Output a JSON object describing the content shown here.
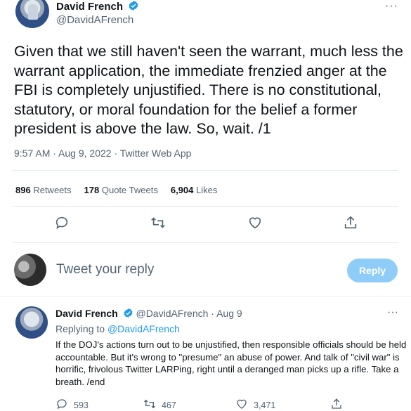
{
  "main_tweet": {
    "author_name": "David French",
    "handle": "@DavidAFrench",
    "more": "···",
    "text": "Given that we still haven't seen the warrant, much less the warrant application, the immediate frenzied anger at the FBI is completely unjustified. There is no constitutional, statutory, or moral foundation for the belief a former president is above the law. So, wait. /1",
    "time": "9:57 AM",
    "date": "Aug 9, 2022",
    "source": "Twitter Web App",
    "stats": {
      "retweets_count": "896",
      "retweets_label": "Retweets",
      "quotes_count": "178",
      "quotes_label": "Quote Tweets",
      "likes_count": "6,904",
      "likes_label": "Likes"
    }
  },
  "composer": {
    "placeholder": "Tweet your reply",
    "reply_button": "Reply"
  },
  "reply_tweet": {
    "author_name": "David French",
    "handle": "@DavidAFrench",
    "date": "Aug 9",
    "replying_prefix": "Replying to",
    "replying_to": "@DavidAFrench",
    "text": "If the DOJ's actions turn out to be unjustified, then responsible officials should be held accountable. But it's wrong to \"presume\" an abuse of power. And talk of \"civil war\" is horrific, frivolous Twitter LARPing, right until a deranged man picks up a rifle. Take a breath. /end",
    "replies": "593",
    "retweets": "467",
    "likes": "3,471"
  },
  "colors": {
    "verified": "#1d9bf0",
    "link": "#1d9bf0",
    "reply_button_disabled": "#8ecdf7",
    "secondary_text": "#536471"
  },
  "icons": [
    "verified-badge-icon",
    "reply-icon",
    "retweet-icon",
    "like-icon",
    "share-icon",
    "more-icon"
  ]
}
